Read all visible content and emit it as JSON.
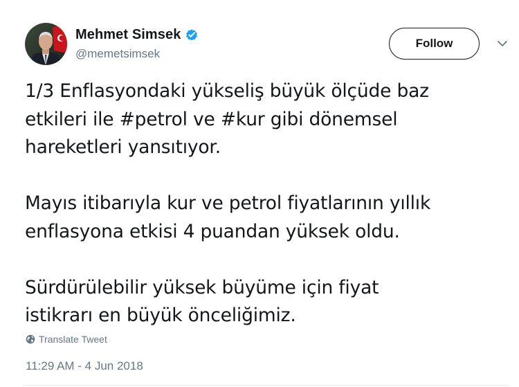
{
  "author": {
    "display_name": "Mehmet Simsek",
    "handle": "@memetsimsek",
    "verified": true
  },
  "follow_button": {
    "label": "Follow"
  },
  "tweet": {
    "paragraphs": [
      {
        "lines": [
          "1/3 Enflasyondaki yükseliş büyük ölçüde baz",
          "etkileri ile #petrol ve #kur gibi dönemsel",
          "hareketleri yansıtıyor."
        ]
      },
      {
        "lines": [
          "Mayıs itibarıyla kur ve petrol fiyatlarının yıllık",
          "enflasyona etkisi 4 puandan yüksek oldu."
        ]
      },
      {
        "lines": [
          "Sürdürülebilir yüksek büyüme için fiyat",
          "istikrarı en büyük önceliğimiz."
        ]
      }
    ],
    "line2_parts": {
      "before": "etkileri ile ",
      "hashtag1": "#petrol",
      "middle": " ve ",
      "hashtag2": "#kur",
      "after": " gibi dönemsel"
    }
  },
  "translate": {
    "label": "Translate Tweet"
  },
  "timestamp": "11:29 AM - 4 Jun 2018",
  "colors": {
    "text": "#14171a",
    "secondary": "#657786",
    "verified_badge": "#1da1f2",
    "divider": "#e6ecf0"
  },
  "icons": {
    "verified": "verified-badge-icon",
    "caret": "chevron-down-icon",
    "globe": "globe-icon"
  }
}
